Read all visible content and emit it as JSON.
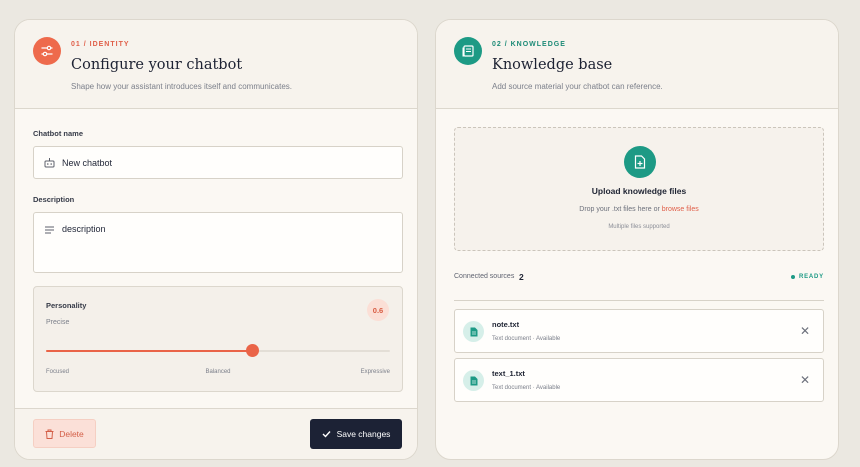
{
  "identity": {
    "eyebrow": "01 / IDENTITY",
    "title": "Configure your chatbot",
    "subtitle": "Shape how your assistant introduces itself and communicates.",
    "name_label": "Chatbot name",
    "name_value": "New chatbot",
    "description_label": "Description",
    "description_value": "description",
    "personality": {
      "label": "Personality",
      "value_label": "Precise",
      "value": "0.6",
      "level_fraction": 0.6,
      "ticks": [
        "Focused",
        "Balanced",
        "Expressive"
      ]
    },
    "delete_label": "Delete",
    "save_label": "Save changes"
  },
  "knowledge": {
    "eyebrow": "02 / KNOWLEDGE",
    "title": "Knowledge base",
    "subtitle": "Add source material your chatbot can reference.",
    "upload_title": "Upload knowledge files",
    "upload_hint_prefix": "Drop your .txt files here or",
    "upload_hint_link": "browse files",
    "upload_note": "Multiple files supported",
    "sources_label": "Connected sources",
    "sources_count": "2",
    "status": "READY",
    "files": [
      {
        "name": "note.txt",
        "meta": "Text document · Available"
      },
      {
        "name": "text_1.txt",
        "meta": "Text document · Available"
      }
    ]
  },
  "colors": {
    "accent_orange": "#ee6a4c",
    "accent_teal": "#1d9a85",
    "save_button": "#1c2235"
  }
}
